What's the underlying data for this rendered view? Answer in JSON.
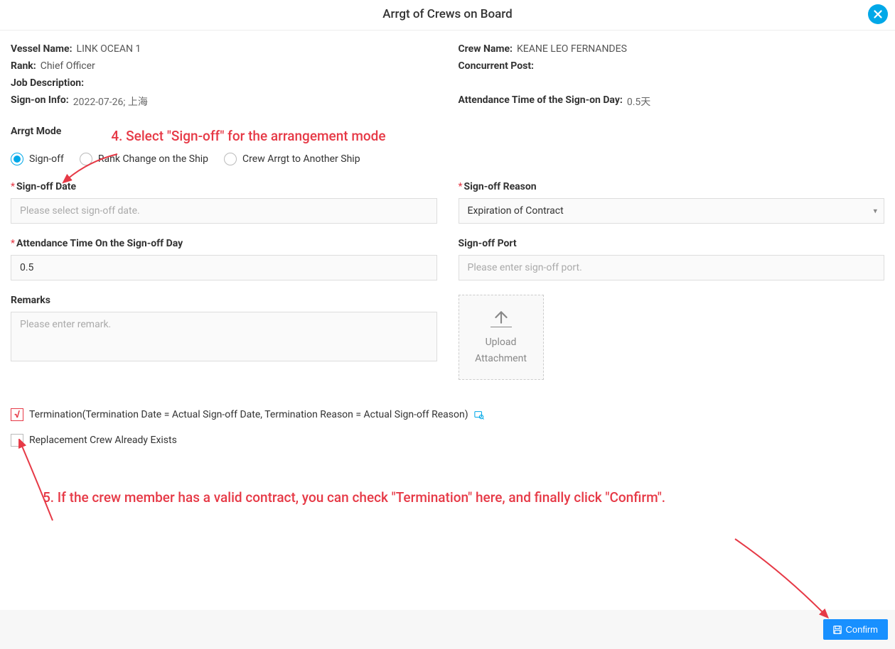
{
  "header": {
    "title": "Arrgt of Crews on Board"
  },
  "info": {
    "vessel_name_label": "Vessel Name:",
    "vessel_name_value": "LINK OCEAN 1",
    "crew_name_label": "Crew Name:",
    "crew_name_value": "KEANE LEO FERNANDES",
    "rank_label": "Rank:",
    "rank_value": "Chief Officer",
    "concurrent_post_label": "Concurrent Post:",
    "concurrent_post_value": "",
    "job_desc_label": "Job Description:",
    "job_desc_value": "",
    "signon_info_label": "Sign-on Info:",
    "signon_info_value": "2022-07-26; 上海",
    "attendance_signon_label": "Attendance Time of the Sign-on Day:",
    "attendance_signon_value": "0.5天"
  },
  "arrgt": {
    "heading": "Arrgt Mode",
    "radio_signoff": "Sign-off",
    "radio_rank_change": "Rank Change on the Ship",
    "radio_another_ship": "Crew Arrgt to Another Ship"
  },
  "form": {
    "signoff_date_label": "Sign-off Date",
    "signoff_date_placeholder": "Please select sign-off date.",
    "signoff_reason_label": "Sign-off Reason",
    "signoff_reason_value": "Expiration of Contract",
    "attendance_signoff_label": "Attendance Time On the Sign-off Day",
    "attendance_signoff_value": "0.5",
    "signoff_port_label": "Sign-off Port",
    "signoff_port_placeholder": "Please enter sign-off port.",
    "remarks_label": "Remarks",
    "remarks_placeholder": "Please enter remark.",
    "upload_label": "Upload\nAttachment"
  },
  "checkboxes": {
    "termination_label": "Termination(Termination Date = Actual Sign-off Date, Termination Reason = Actual Sign-off Reason)",
    "replacement_label": "Replacement Crew Already Exists"
  },
  "annotations": {
    "step4": "4. Select \"Sign-off\" for the arrangement mode",
    "step5": "5. If the crew member has a valid contract, you can check \"Termination\" here, and finally click \"Confirm\"."
  },
  "footer": {
    "confirm_label": "Confirm"
  }
}
